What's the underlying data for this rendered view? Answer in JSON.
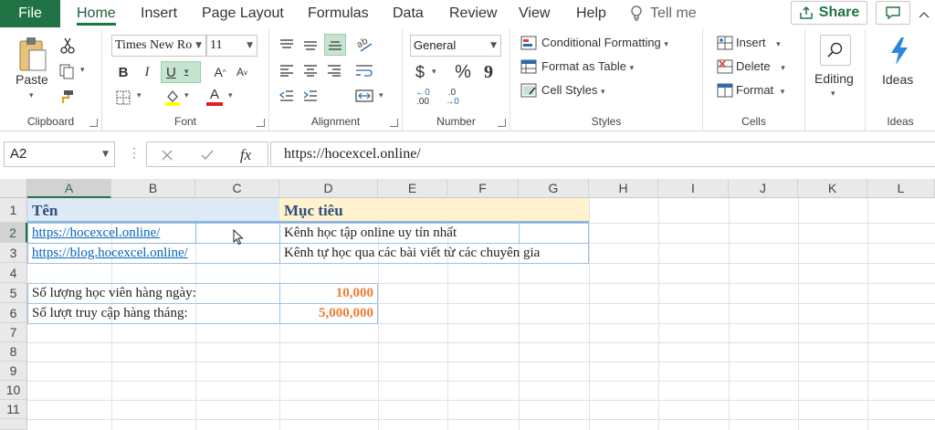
{
  "menu": {
    "file": "File",
    "tabs": [
      "Home",
      "Insert",
      "Page Layout",
      "Formulas",
      "Data",
      "Review",
      "View",
      "Help"
    ],
    "active_tab": "Home",
    "tell_me": "Tell me",
    "share": "Share"
  },
  "ribbon": {
    "clipboard": {
      "label": "Clipboard",
      "paste": "Paste"
    },
    "font": {
      "label": "Font",
      "font_name": "Times New Ro",
      "font_size": "11",
      "bold": "B",
      "italic": "I",
      "underline": "U",
      "grow": "A",
      "shrink": "A",
      "color_letter": "A"
    },
    "alignment": {
      "label": "Alignment"
    },
    "number": {
      "label": "Number",
      "format": "General",
      "currency": "$",
      "percent": "%",
      "comma": "9",
      "inc_decimal": ".00",
      "dec_decimal": ".0"
    },
    "styles": {
      "label": "Styles",
      "conditional": "Conditional Formatting",
      "format_table": "Format as Table",
      "cell_styles": "Cell Styles"
    },
    "cells": {
      "label": "Cells",
      "insert": "Insert",
      "delete": "Delete",
      "format": "Format"
    },
    "editing": {
      "label": "Editing"
    },
    "ideas": {
      "label": "Ideas",
      "button": "Ideas"
    }
  },
  "formula_bar": {
    "name_box": "A2",
    "formula": "https://hocexcel.online/"
  },
  "columns": [
    "A",
    "B",
    "C",
    "D",
    "E",
    "F",
    "G",
    "H",
    "I",
    "J",
    "K",
    "L"
  ],
  "rows": [
    "1",
    "2",
    "3",
    "4",
    "5",
    "6",
    "7",
    "8",
    "9",
    "10",
    "11"
  ],
  "cells": {
    "A1": "Tên",
    "D1": "Mục tiêu",
    "A2": "https://hocexcel.online/",
    "D2": "Kênh học tập online uy tín nhất",
    "A3": "https://blog.hocexcel.online/",
    "D3": "Kênh tự học qua các bài viết từ các chuyên gia",
    "A5": "Số lượng học viên hàng ngày:",
    "D5": "10,000",
    "A6": "Số lượt truy cập hàng tháng:",
    "D6": "5,000,000"
  },
  "colors": {
    "accent": "#217346",
    "header_a1": "#dde9f5",
    "header_d1": "#fff2cc",
    "link": "#0563c1",
    "number": "#ed7d31"
  }
}
